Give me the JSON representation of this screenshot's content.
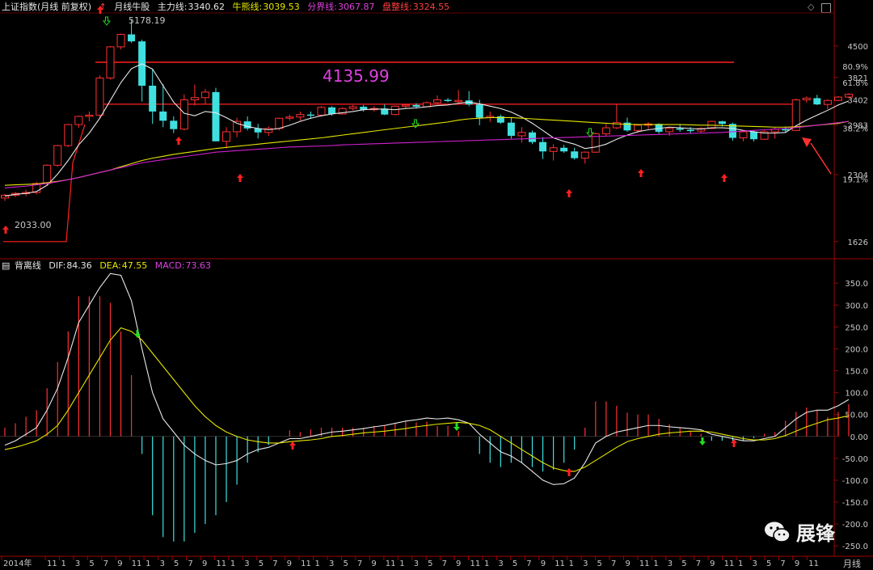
{
  "header": {
    "index_name": "上证指数(月线 前复权)",
    "arrow": "↑",
    "indicator_name": "月线牛股",
    "main_label": "主力线:",
    "main_value": "3340.62",
    "bull_label": "牛熊线:",
    "bull_value": "3039.53",
    "boundary_label": "分界线:",
    "boundary_value": "3067.87",
    "consol_label": "盘整线:",
    "consol_value": "3324.55"
  },
  "macd_header": {
    "name": "背离线",
    "dif_label": "DIF:",
    "dif_value": "84.36",
    "dea_label": "DEA:",
    "dea_value": "47.55",
    "macd_label": "MACD:",
    "macd_value": "73.63"
  },
  "annotations": {
    "big_level": "4135.99",
    "high_label": "5178.19",
    "low_label": "2033.00"
  },
  "right_axis": {
    "price_ticks": [
      "4500",
      "3821",
      "3402",
      "2983",
      "2304",
      "1626"
    ],
    "pct_ticks": [
      "80.9%",
      "61.8%",
      "38.2%",
      "19.1%"
    ],
    "macd_ticks": [
      "350.0",
      "300.0",
      "250.0",
      "200.0",
      "150.0",
      "100.0",
      "50.00",
      "0.00",
      "-50.00",
      "-100.0",
      "-150.0",
      "-200.0",
      "-250.0"
    ]
  },
  "bottom_axis": {
    "labels": [
      "2014年",
      "11",
      "1",
      "3",
      "5",
      "7",
      "9",
      "11",
      "1",
      "3",
      "5",
      "7",
      "9",
      "11",
      "1",
      "3",
      "5",
      "7",
      "9",
      "11",
      "1",
      "3",
      "5",
      "7",
      "9",
      "11",
      "1",
      "3",
      "5",
      "7",
      "9",
      "11",
      "1",
      "3",
      "5",
      "7",
      "9",
      "11",
      "1",
      "3",
      "5",
      "7",
      "9",
      "11",
      "1",
      "3",
      "5",
      "7",
      "9",
      "11",
      "1",
      "3",
      "5",
      "7",
      "9",
      "11"
    ],
    "period": "月线"
  },
  "watermark": {
    "text": "展锋",
    "icon": "wechat-icon"
  },
  "colors": {
    "up": "#ff3030",
    "down": "#40e0e0",
    "ma5": "#e8e8e8",
    "ma_yellow": "#e6e600",
    "ma_magenta": "#d020d0",
    "dea": "#e6e600",
    "dif": "#e8e8e8",
    "level": "#ff2020"
  },
  "chart_data": [
    {
      "type": "candlestick",
      "title": "上证指数(月线 前复权)",
      "ylim": [
        1500,
        5300
      ],
      "y_scale": "log",
      "candles": [
        [
          2040,
          2085,
          2010,
          2070
        ],
        [
          2070,
          2105,
          2050,
          2090
        ],
        [
          2090,
          2130,
          2060,
          2100
        ],
        [
          2100,
          2220,
          2080,
          2200
        ],
        [
          2200,
          2430,
          2180,
          2420
        ],
        [
          2420,
          2690,
          2400,
          2680
        ],
        [
          2680,
          3000,
          2660,
          2990
        ],
        [
          2990,
          3130,
          2940,
          3120
        ],
        [
          3120,
          3200,
          3040,
          3140
        ],
        [
          3140,
          3860,
          3100,
          3810
        ],
        [
          3810,
          4500,
          3780,
          4480
        ],
        [
          4480,
          4800,
          4420,
          4780
        ],
        [
          4780,
          5178,
          4570,
          4610
        ],
        [
          4610,
          4650,
          3370,
          3660
        ],
        [
          3660,
          4000,
          3000,
          3200
        ],
        [
          3200,
          3690,
          2950,
          3050
        ],
        [
          3050,
          3120,
          2860,
          2920
        ],
        [
          2920,
          3500,
          2900,
          3400
        ],
        [
          3400,
          3680,
          3300,
          3440
        ],
        [
          3440,
          3600,
          3330,
          3540
        ],
        [
          3540,
          3620,
          2740,
          2740
        ],
        [
          2740,
          2950,
          2640,
          2880
        ],
        [
          2880,
          3100,
          2800,
          3040
        ],
        [
          3040,
          3120,
          2900,
          2930
        ],
        [
          2930,
          3000,
          2780,
          2870
        ],
        [
          2870,
          2960,
          2820,
          2930
        ],
        [
          2930,
          3100,
          2900,
          3090
        ],
        [
          3090,
          3150,
          3050,
          3110
        ],
        [
          3110,
          3200,
          3050,
          3150
        ],
        [
          3150,
          3200,
          3080,
          3140
        ],
        [
          3140,
          3290,
          3120,
          3270
        ],
        [
          3270,
          3290,
          3130,
          3160
        ],
        [
          3160,
          3270,
          3150,
          3250
        ],
        [
          3250,
          3310,
          3220,
          3280
        ],
        [
          3280,
          3310,
          3200,
          3230
        ],
        [
          3230,
          3290,
          3200,
          3250
        ],
        [
          3250,
          3320,
          3140,
          3150
        ],
        [
          3150,
          3300,
          3140,
          3290
        ],
        [
          3290,
          3320,
          3250,
          3310
        ],
        [
          3310,
          3340,
          3250,
          3280
        ],
        [
          3280,
          3370,
          3270,
          3350
        ],
        [
          3350,
          3480,
          3320,
          3400
        ],
        [
          3400,
          3430,
          3360,
          3380
        ],
        [
          3380,
          3580,
          3340,
          3390
        ],
        [
          3390,
          3560,
          3290,
          3320
        ],
        [
          3320,
          3400,
          2980,
          3100
        ],
        [
          3100,
          3200,
          3030,
          3120
        ],
        [
          3120,
          3150,
          3000,
          3020
        ],
        [
          3020,
          3100,
          2780,
          2820
        ],
        [
          2820,
          2950,
          2720,
          2870
        ],
        [
          2870,
          2900,
          2700,
          2730
        ],
        [
          2730,
          2800,
          2500,
          2600
        ],
        [
          2600,
          2700,
          2480,
          2650
        ],
        [
          2650,
          2690,
          2580,
          2600
        ],
        [
          2600,
          2650,
          2490,
          2510
        ],
        [
          2510,
          2600,
          2440,
          2590
        ],
        [
          2590,
          2870,
          2580,
          2850
        ],
        [
          2850,
          3000,
          2810,
          2940
        ],
        [
          2940,
          3330,
          2920,
          3020
        ],
        [
          3020,
          3100,
          2880,
          2900
        ],
        [
          2900,
          3000,
          2860,
          2980
        ],
        [
          2980,
          3030,
          2920,
          3000
        ],
        [
          3000,
          3010,
          2850,
          2880
        ],
        [
          2880,
          2950,
          2820,
          2930
        ],
        [
          2930,
          3000,
          2880,
          2910
        ],
        [
          2910,
          2950,
          2860,
          2890
        ],
        [
          2890,
          2950,
          2860,
          2930
        ],
        [
          2930,
          3050,
          2920,
          3040
        ],
        [
          3040,
          3050,
          2960,
          3000
        ],
        [
          3000,
          3020,
          2750,
          2790
        ],
        [
          2790,
          2900,
          2740,
          2880
        ],
        [
          2880,
          2900,
          2740,
          2770
        ],
        [
          2770,
          2900,
          2760,
          2880
        ],
        [
          2880,
          2950,
          2780,
          2920
        ],
        [
          2920,
          2960,
          2870,
          2900
        ],
        [
          2900,
          3420,
          2890,
          3400
        ],
        [
          3400,
          3460,
          3350,
          3430
        ],
        [
          3430,
          3490,
          3310,
          3320
        ],
        [
          3320,
          3410,
          3240,
          3390
        ],
        [
          3390,
          3470,
          3380,
          3450
        ],
        [
          3450,
          3520,
          3430,
          3500
        ]
      ],
      "series": [
        {
          "name": "主力线",
          "values": [
            2060,
            2080,
            2090,
            2110,
            2180,
            2310,
            2480,
            2690,
            2860,
            3090,
            3390,
            3720,
            4000,
            4100,
            3990,
            3660,
            3360,
            3170,
            3130,
            3200,
            3180,
            3100,
            3010,
            2960,
            2930,
            2910,
            2930,
            2980,
            3040,
            3090,
            3130,
            3160,
            3180,
            3200,
            3230,
            3240,
            3240,
            3230,
            3250,
            3260,
            3280,
            3300,
            3310,
            3340,
            3360,
            3330,
            3290,
            3250,
            3190,
            3110,
            3010,
            2900,
            2790,
            2740,
            2700,
            2640,
            2660,
            2700,
            2770,
            2830,
            2880,
            2910,
            2930,
            2950,
            2940,
            2930,
            2920,
            2940,
            2940,
            2930,
            2900,
            2880,
            2860,
            2860,
            2870,
            2970,
            3060,
            3140,
            3220,
            3310,
            3380
          ]
        },
        {
          "name": "牛熊线",
          "values": [
            2180,
            2185,
            2190,
            2195,
            2210,
            2225,
            2245,
            2270,
            2300,
            2330,
            2360,
            2400,
            2440,
            2480,
            2510,
            2535,
            2560,
            2580,
            2600,
            2620,
            2640,
            2655,
            2670,
            2685,
            2700,
            2715,
            2730,
            2745,
            2760,
            2775,
            2790,
            2810,
            2830,
            2850,
            2870,
            2890,
            2910,
            2930,
            2950,
            2970,
            2990,
            3010,
            3030,
            3060,
            3080,
            3090,
            3100,
            3100,
            3100,
            3090,
            3080,
            3070,
            3060,
            3050,
            3040,
            3030,
            3020,
            3010,
            3000,
            2995,
            2990,
            2990,
            2990,
            2990,
            2990,
            2985,
            2980,
            2980,
            2975,
            2970,
            2965,
            2960,
            2955,
            2950,
            2950,
            2955,
            2965,
            2980,
            2995,
            3010,
            3040
          ]
        },
        {
          "name": "分界线",
          "values": [
            2150,
            2160,
            2170,
            2185,
            2200,
            2220,
            2245,
            2270,
            2300,
            2330,
            2360,
            2390,
            2420,
            2450,
            2470,
            2490,
            2510,
            2530,
            2550,
            2570,
            2590,
            2600,
            2610,
            2620,
            2630,
            2640,
            2650,
            2660,
            2665,
            2670,
            2675,
            2680,
            2690,
            2695,
            2700,
            2705,
            2710,
            2715,
            2720,
            2725,
            2730,
            2735,
            2740,
            2745,
            2750,
            2755,
            2760,
            2765,
            2770,
            2775,
            2780,
            2785,
            2790,
            2795,
            2800,
            2805,
            2810,
            2815,
            2820,
            2825,
            2830,
            2835,
            2840,
            2845,
            2850,
            2855,
            2860,
            2865,
            2870,
            2880,
            2890,
            2900,
            2910,
            2920,
            2930,
            2945,
            2960,
            2980,
            3000,
            3020,
            3040
          ]
        },
        {
          "name": "盘整线",
          "values": []
        }
      ]
    },
    {
      "type": "macd",
      "ylim": [
        -270,
        380
      ],
      "series": [
        {
          "name": "DIF",
          "values": [
            -20,
            -10,
            5,
            20,
            60,
            110,
            180,
            260,
            300,
            340,
            372,
            368,
            310,
            200,
            100,
            40,
            10,
            -20,
            -40,
            -55,
            -65,
            -62,
            -55,
            -40,
            -30,
            -25,
            -15,
            -5,
            -5,
            0,
            5,
            10,
            12,
            15,
            18,
            22,
            25,
            30,
            35,
            38,
            42,
            40,
            42,
            38,
            30,
            5,
            -15,
            -35,
            -45,
            -60,
            -80,
            -100,
            -110,
            -108,
            -95,
            -60,
            -15,
            0,
            10,
            15,
            20,
            25,
            25,
            22,
            20,
            18,
            15,
            5,
            0,
            -5,
            -10,
            -10,
            -5,
            0,
            20,
            40,
            55,
            60,
            60,
            70,
            84.36
          ]
        },
        {
          "name": "DEA",
          "values": [
            -30,
            -25,
            -18,
            -10,
            5,
            25,
            60,
            100,
            140,
            180,
            220,
            248,
            240,
            220,
            190,
            160,
            130,
            100,
            70,
            45,
            25,
            10,
            0,
            -8,
            -12,
            -15,
            -15,
            -12,
            -10,
            -8,
            -5,
            0,
            2,
            5,
            8,
            10,
            12,
            15,
            18,
            22,
            25,
            28,
            30,
            32,
            30,
            25,
            15,
            0,
            -15,
            -30,
            -45,
            -60,
            -72,
            -78,
            -80,
            -70,
            -55,
            -40,
            -25,
            -12,
            -5,
            0,
            5,
            8,
            10,
            12,
            12,
            10,
            5,
            0,
            -5,
            -8,
            -8,
            -5,
            2,
            12,
            22,
            30,
            38,
            42,
            47.55
          ]
        },
        {
          "name": "MACD",
          "values": [
            20,
            30,
            45,
            60,
            110,
            170,
            240,
            320,
            320,
            320,
            305,
            240,
            140,
            -40,
            -180,
            -230,
            -240,
            -240,
            -220,
            -200,
            -180,
            -150,
            -110,
            -60,
            -36,
            -20,
            0,
            14,
            10,
            16,
            20,
            20,
            20,
            20,
            20,
            24,
            26,
            30,
            34,
            32,
            34,
            24,
            24,
            12,
            0,
            -40,
            -60,
            -70,
            -60,
            -60,
            -70,
            -80,
            -76,
            -60,
            -30,
            20,
            80,
            80,
            70,
            54,
            50,
            50,
            40,
            28,
            20,
            12,
            6,
            -10,
            -10,
            -10,
            -10,
            -4,
            6,
            10,
            36,
            56,
            66,
            60,
            44,
            56,
            73.63
          ]
        }
      ]
    }
  ]
}
